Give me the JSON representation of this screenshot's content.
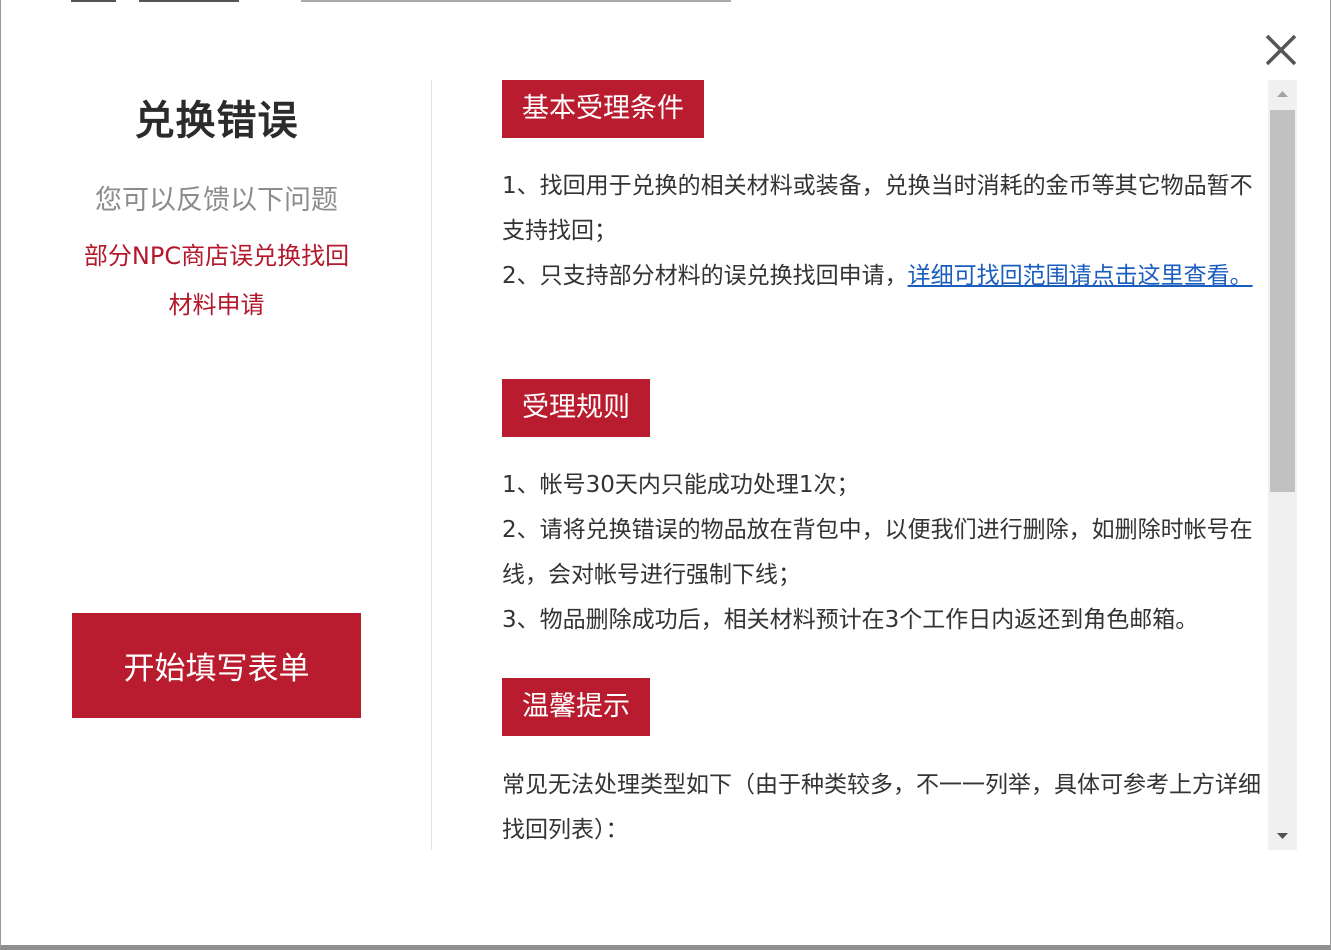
{
  "dialog": {
    "close_icon": "close-icon"
  },
  "sidebar": {
    "title": "兑换错误",
    "subtitle": "您可以反馈以下问题",
    "issue_line1": "部分NPC商店误兑换找回",
    "issue_line2": "材料申请",
    "start_button": "开始填写表单",
    "colors": {
      "accent": "#b81c2e",
      "issue_text": "#b3182b"
    }
  },
  "sections": [
    {
      "heading": "基本受理条件",
      "line1": "1、找回用于兑换的相关材料或装备，兑换当时消耗的金币等其它物品暂不支持找回；",
      "line2_prefix": "2、只支持部分材料的误兑换找回申请，",
      "line2_link": "详细可找回范围请点击这里查看。"
    },
    {
      "heading": "受理规则",
      "line1": "1、帐号30天内只能成功处理1次；",
      "line2": "2、请将兑换错误的物品放在背包中，以便我们进行删除，如删除时帐号在线，会对帐号进行强制下线；",
      "line3": "3、物品删除成功后，相关材料预计在3个工作日内返还到角色邮箱。"
    },
    {
      "heading": "温馨提示",
      "line1": "常见无法处理类型如下（由于种类较多，不一一列举，具体可参考上方详细找回列表）："
    }
  ],
  "scrollbar": {
    "up_icon": "scroll-up-arrow-icon",
    "down_icon": "scroll-down-arrow-icon"
  }
}
